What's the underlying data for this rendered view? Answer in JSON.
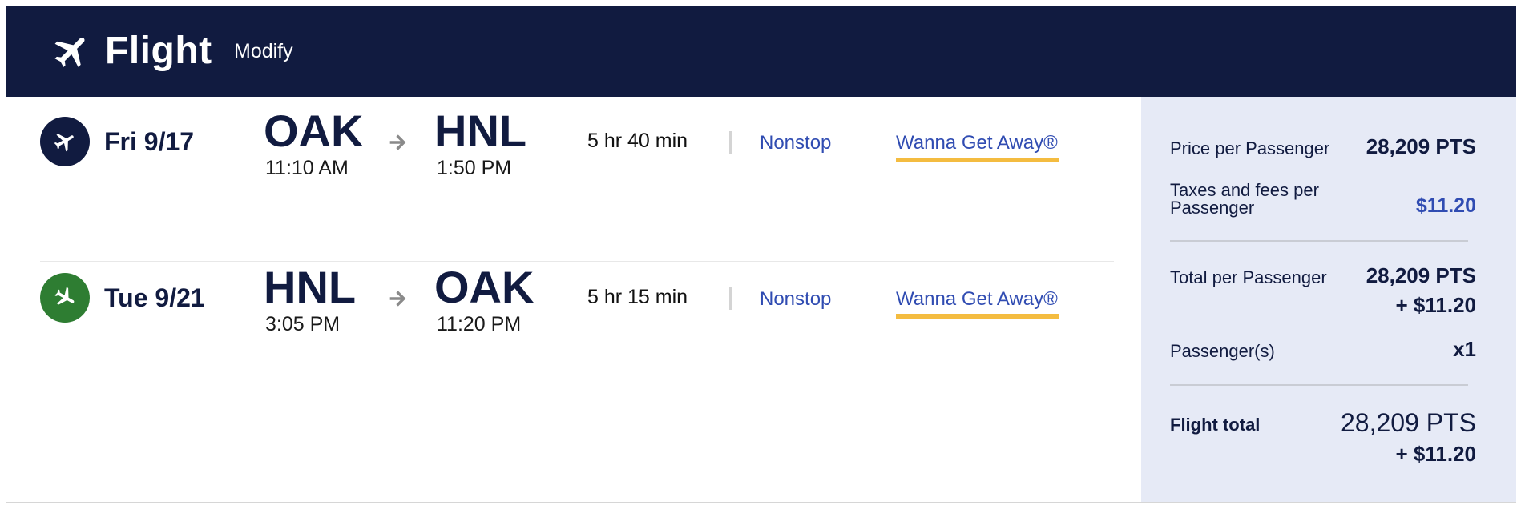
{
  "header": {
    "icon": "airplane-icon",
    "title": "Flight",
    "modify_label": "Modify",
    "background": "#111b40"
  },
  "flights": [
    {
      "icon": "airplane-takeoff-icon",
      "icon_color": "#111b40",
      "date": "Fri 9/17",
      "origin_code": "OAK",
      "departure_time": "11:10 AM",
      "destination_code": "HNL",
      "arrival_time": "1:50 PM",
      "duration": "5 hr 40 min",
      "stops": "Nonstop",
      "fare": "Wanna Get Away®"
    },
    {
      "icon": "airplane-landing-icon",
      "icon_color": "#2e7d32",
      "date": "Tue 9/21",
      "origin_code": "HNL",
      "departure_time": "3:05 PM",
      "destination_code": "OAK",
      "arrival_time": "11:20 PM",
      "duration": "5 hr 15 min",
      "stops": "Nonstop",
      "fare": "Wanna Get Away®"
    }
  ],
  "summary": {
    "price_label": "Price per Passenger",
    "price_value": "28,209 PTS",
    "taxes_label_line1": "Taxes and fees per",
    "taxes_label_line2": "Passenger",
    "taxes_value": "$11.20",
    "total_label": "Total per Passenger",
    "total_value_line1": "28,209 PTS",
    "total_value_line2": "+ $11.20",
    "passengers_label": "Passenger(s)",
    "passengers_value": "x1",
    "flight_total_label": "Flight total",
    "flight_total_line1": "28,209 PTS",
    "flight_total_line2": "+ $11.20"
  },
  "colors": {
    "navy": "#111b40",
    "link_blue": "#304cb2",
    "fare_underline": "#f4bc40",
    "sidebar_bg": "#e6eaf6",
    "return_green": "#2e7d32"
  }
}
